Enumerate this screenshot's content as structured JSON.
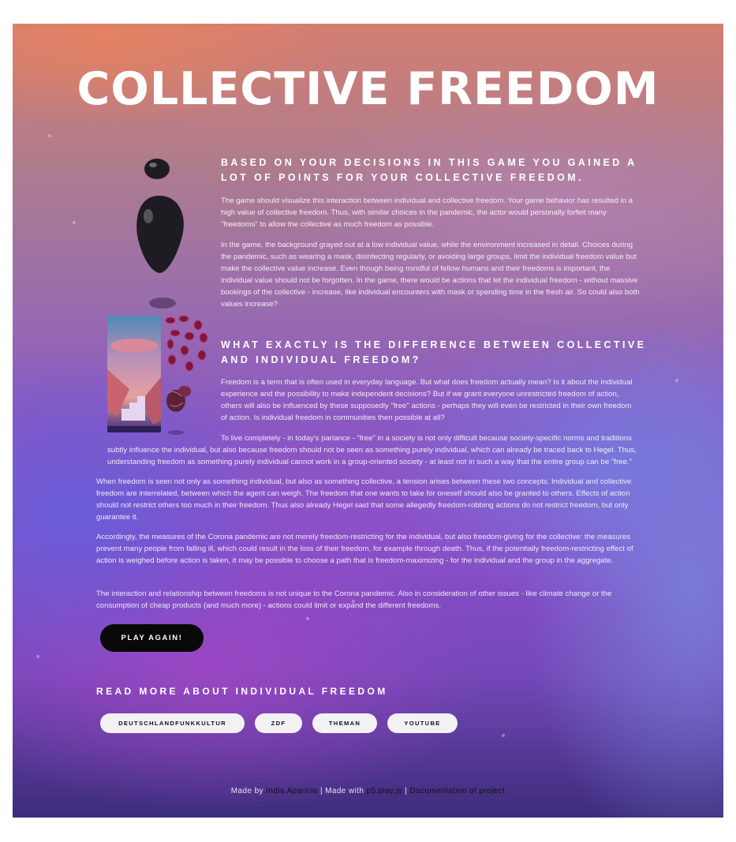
{
  "title": "COLLECTIVE FREEDOM",
  "section1": {
    "heading": "BASED ON YOUR DECISIONS IN THIS GAME YOU GAINED A LOT OF POINTS FOR YOUR COLLECTIVE FREEDOM.",
    "paragraphs": [
      "The game should visualize this interaction between individual and collective freedom. Your game behavior has resulted in a high value of collective freedom. Thus, with similar choices in the pandemic, the actor would personally forfeit many \"freedoms\" to allow the collective as much freedom as possible.",
      "In the game, the background grayed out at a low individual value, while the environment increased in detail. Choices during the pandemic, such as wearing a mask, disinfecting regularly, or avoiding large groups, limit the individual freedom value but make the collective value increase. Even though being mindful of fellow humans and their freedoms is important, the individual value should not be forgotten. In the game, there would be actions that let the individual freedom - without massive bookings of the collective - increase, like individual encounters with mask or spending time in the fresh air. So could also both values increase?"
    ]
  },
  "section2": {
    "heading": "WHAT EXACTLY IS THE DIFFERENCE BETWEEN COLLECTIVE AND INDIVIDUAL FREEDOM?",
    "paragraphs": [
      "Freedom is a term that is often used in everyday language. But what does freedom actually mean? Is it about the individual experience and the possibility to make independent decisions? But if we grant everyone unrestricted freedom of action, others will also be influenced by these supposedly \"free\" actions - perhaps they will even be restricted in their own freedom of action. Is individual freedom in communities then possible at all?",
      "To live completely - in today's parlance - \"free\" in a society is not only difficult because society-specific norms and traditions subtly influence the individual, but also because freedom should not be seen as something purely individual, which can already be traced back to Hegel. Thus, understanding freedom as something purely individual cannot work in a group-oriented society - at least not in such a way that the entire group can be \"free.\"",
      "When freedom is seen not only as something individual, but also as something collective, a tension arises between these two concepts. Individual and collective freedom are interrelated, between which the agent can weigh. The freedom that one wants to take for oneself should also be granted to others. Effects of action should not restrict others too much in their freedom. Thus also already Hegel said that some allegedly freedom-robbing actions do not restrict freedom, but only guarantee it.",
      "Accordingly, the measures of the Corona pandemic are not merely freedom-restricting for the individual, but also freedom-giving for the collective: the measures prevent many people from falling ill, which could result in the loss of their freedom, for example through death. Thus, if the potentially freedom-restricting effect of action is weighed before action is taken, it may be possible to choose a path that is freedom-maximizing - for the individual and the group in the aggregate.",
      "The interaction and relationship between freedoms is not unique to the Corona pandemic. Also in consideration of other issues - like climate change or the consumption of cheap products (and much more) - actions could limit or expand the different freedoms."
    ]
  },
  "play_button": "PLAY AGAIN!",
  "read_more": {
    "heading": "READ MORE ABOUT INDIVIDUAL FREEDOM",
    "links": [
      "DEUTSCHLANDFUNKKULTUR",
      "ZDF",
      "THEMAN",
      "YOUTUBE"
    ]
  },
  "footer": {
    "made_by": "Made by",
    "author": "India Aparicio",
    "sep1": "|",
    "made_with": "Made with",
    "library": "p5.play.js",
    "sep2": "|",
    "docs": "Documentation of project"
  },
  "colors": {
    "accent_button": "#080808",
    "link_button_bg": "#f2f1f4",
    "title": "#ffffff"
  }
}
